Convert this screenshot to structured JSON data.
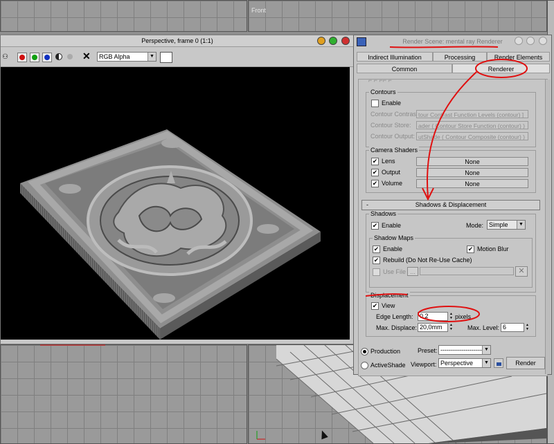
{
  "viewports": {
    "front_label": "Front"
  },
  "frame_window": {
    "title": "Perspective, frame 0 (1:1)",
    "channel_select": "RGB Alpha",
    "color_channels": [
      {
        "name": "red-channel",
        "color": "#d01010"
      },
      {
        "name": "green-channel",
        "color": "#10a010"
      },
      {
        "name": "blue-channel",
        "color": "#1030c0"
      },
      {
        "name": "alpha-channel",
        "color": "#222222"
      },
      {
        "name": "mono-channel",
        "color": "#aaaaaa"
      }
    ]
  },
  "dialog": {
    "title": "Render Scene: mental ray Renderer",
    "tabs_row1": [
      "Indirect Illumination",
      "Processing",
      "Render Elements"
    ],
    "tabs_row2": [
      "Common",
      "Renderer"
    ],
    "active_tab": "Renderer",
    "contours": {
      "group_title": "Contours",
      "enable_label": "Enable",
      "rows": [
        {
          "label": "Contour Contrast:",
          "value": "tour Contrast Function Levels (contour) ]"
        },
        {
          "label": "Contour Store:",
          "value": "ader ( Contour Store Function (contour) )"
        },
        {
          "label": "Contour Output:",
          "value": "utShade ( Contour Composite (contour) )"
        }
      ]
    },
    "camera_shaders": {
      "group_title": "Camera Shaders",
      "rows": [
        {
          "label": "Lens",
          "value": "None"
        },
        {
          "label": "Output",
          "value": "None"
        },
        {
          "label": "Volume",
          "value": "None"
        }
      ]
    },
    "shadows_rollout": {
      "collapse_symbol": "-",
      "title": "Shadows & Displacement"
    },
    "shadows": {
      "group_title": "Shadows",
      "enable_label": "Enable",
      "mode_label": "Mode:",
      "mode_value": "Simple"
    },
    "shadow_maps": {
      "group_title": "Shadow Maps",
      "enable_label": "Enable",
      "motion_blur_label": "Motion Blur",
      "rebuild_label": "Rebuild (Do Not Re-Use Cache)",
      "use_file_label": "Use File",
      "browse_label": "..."
    },
    "displacement": {
      "group_title": "Displacement",
      "view_label": "View",
      "edge_length_label": "Edge Length:",
      "edge_length_value": "0,2",
      "edge_length_unit": "pixels",
      "max_displace_label": "Max. Displace:",
      "max_displace_value": "20,0mm",
      "max_level_label": "Max. Level:",
      "max_level_value": "6"
    },
    "bottom": {
      "production_label": "Production",
      "activeshade_label": "ActiveShade",
      "preset_label": "Preset:",
      "preset_value": "--------------------",
      "viewport_label": "Viewport:",
      "viewport_value": "Perspective",
      "render_label": "Render"
    }
  },
  "colors": {
    "annotation_red": "#e01010",
    "panel_bg": "#c6c6c6",
    "render_bg": "#000000"
  }
}
